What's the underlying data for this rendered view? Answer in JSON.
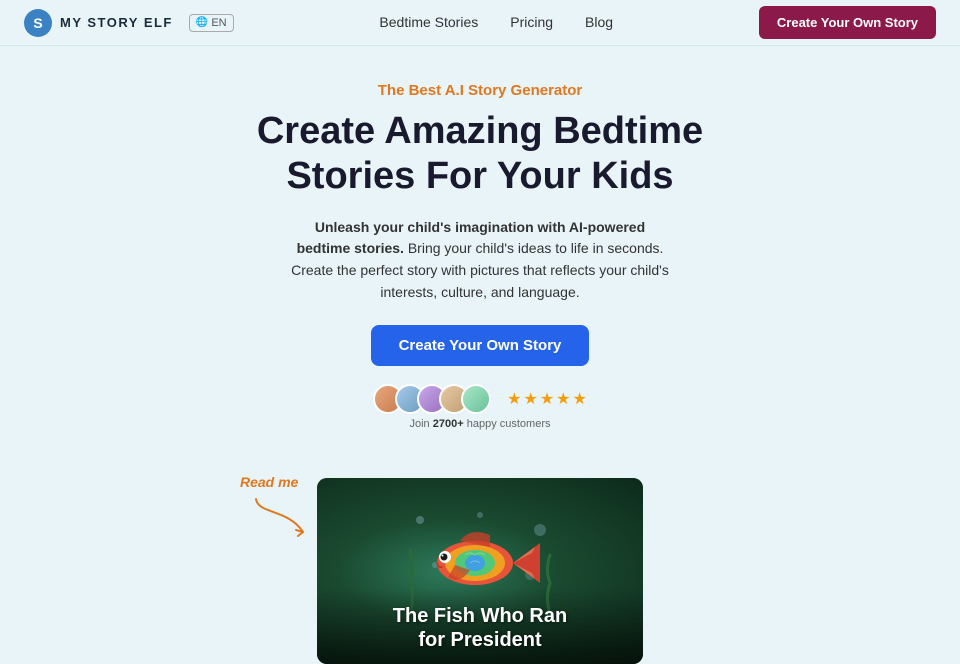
{
  "navbar": {
    "logo_letter": "S",
    "logo_text": "MY STORY ELF",
    "lang": "EN",
    "links": [
      {
        "label": "Bedtime Stories",
        "href": "#"
      },
      {
        "label": "Pricing",
        "href": "#"
      },
      {
        "label": "Blog",
        "href": "#"
      }
    ],
    "cta_label": "Create Your Own Story"
  },
  "hero": {
    "subtitle": "The Best A.I Story Generator",
    "title_line1": "Create Amazing Bedtime",
    "title_line2": "Stories For Your Kids",
    "desc_bold": "Unleash your child's imagination with AI-powered bedtime stories.",
    "desc_rest": " Bring your child's ideas to life in seconds. Create the perfect story with pictures that reflects your child's interests, culture, and language.",
    "cta_label": "Create Your Own Story"
  },
  "social_proof": {
    "customers_count": "2700+",
    "customers_label": "happy customers",
    "join_prefix": "Join ",
    "stars": 5
  },
  "story_card": {
    "read_me_label": "Read me",
    "title": "The Fish Who Ran\nfor President"
  }
}
